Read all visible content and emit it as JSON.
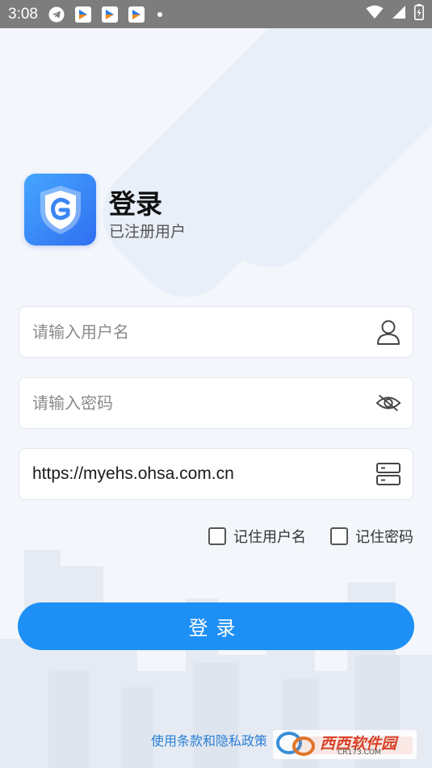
{
  "status_bar": {
    "time": "3:08",
    "icons": [
      "telegram-icon",
      "app-icon",
      "app-icon",
      "app-icon",
      "dot-icon"
    ],
    "right_icons": [
      "wifi-icon",
      "signal-icon",
      "battery-icon"
    ]
  },
  "header": {
    "title": "登录",
    "subtitle": "已注册用户"
  },
  "form": {
    "username_placeholder": "请输入用户名",
    "password_placeholder": "请输入密码",
    "server_url": "https://myehs.ohsa.com.cn",
    "remember_username": "记住用户名",
    "remember_password": "记住密码",
    "login_label": "登录"
  },
  "footer": {
    "terms_link": "使用条款和隐私政策"
  },
  "watermark": {
    "brand": "西西软件园",
    "domain": "CR173.COM"
  },
  "colors": {
    "accent": "#1e90f5",
    "background": "#f3f6fb",
    "status_bar": "#7d7d7d"
  }
}
